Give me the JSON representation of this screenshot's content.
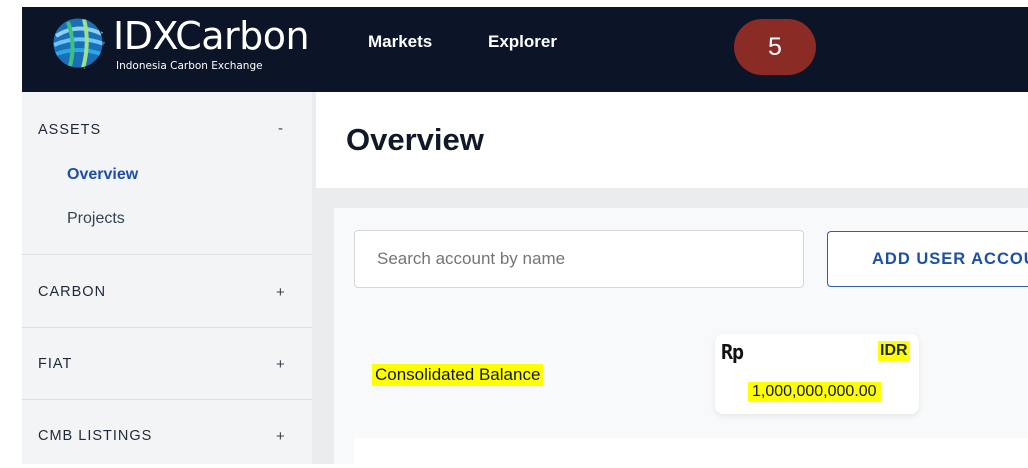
{
  "brand": {
    "title": "IDXCarbon",
    "subtitle": "Indonesia Carbon Exchange"
  },
  "nav": {
    "markets": "Markets",
    "explorer": "Explorer"
  },
  "step_badge": "5",
  "sidebar": {
    "sections": [
      {
        "title": "ASSETS",
        "toggle": "-",
        "items": [
          {
            "label": "Overview",
            "active": true
          },
          {
            "label": "Projects",
            "active": false
          }
        ]
      },
      {
        "title": "CARBON",
        "toggle": "+"
      },
      {
        "title": "FIAT",
        "toggle": "+"
      },
      {
        "title": "CMB LISTINGS",
        "toggle": "+"
      }
    ]
  },
  "main": {
    "page_title": "Overview",
    "search_placeholder": "Search account by name",
    "add_button": "ADD USER ACCOUNT",
    "consolidated_label": "Consolidated Balance",
    "balance": {
      "symbol": "Rp",
      "currency": "IDR",
      "amount": "1,000,000,000.00"
    }
  },
  "colors": {
    "topbar": "#0c1427",
    "accent": "#1e4fa8",
    "badge": "#8b2b25",
    "highlight": "#ffff00",
    "sidebar_bg": "#f3f4f6"
  },
  "icons": {
    "logo": "globe-icon",
    "currency": "rupiah-icon"
  }
}
